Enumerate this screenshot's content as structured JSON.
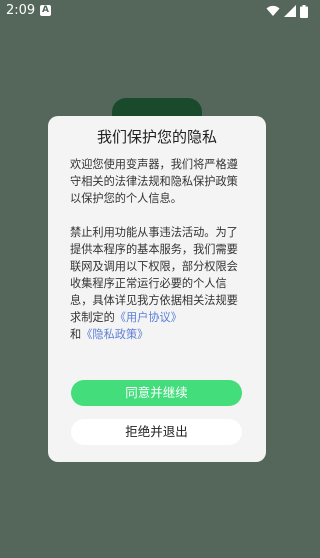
{
  "status_bar": {
    "time": "2:09",
    "notification_glyph": "A",
    "icons": [
      "wifi-icon",
      "cellular-signal-icon",
      "battery-icon"
    ]
  },
  "dialog": {
    "title": "我们保护您的隐私",
    "paragraph1": "欢迎您使用变声器，我们将严格遵守相关的法律法规和隐私保护政策以保护您的个人信息。",
    "paragraph2": "禁止利用功能从事违法活动。为了提供本程序的基本服务，我们需要联网及调用以下权限，部分权限会收集程序正常运行必要的个人信息，具体详见我方依据相关法规要求制定的",
    "user_agreement_link": "《用户协议》",
    "and_text": "和",
    "privacy_policy_link": "《隐私政策》",
    "agree_button": "同意并继续",
    "reject_button": "拒绝并退出"
  },
  "colors": {
    "background": "#55675a",
    "dialog_background": "#f4f4f4",
    "agree_button": "#43dd7c",
    "link": "#5b7fd6"
  }
}
